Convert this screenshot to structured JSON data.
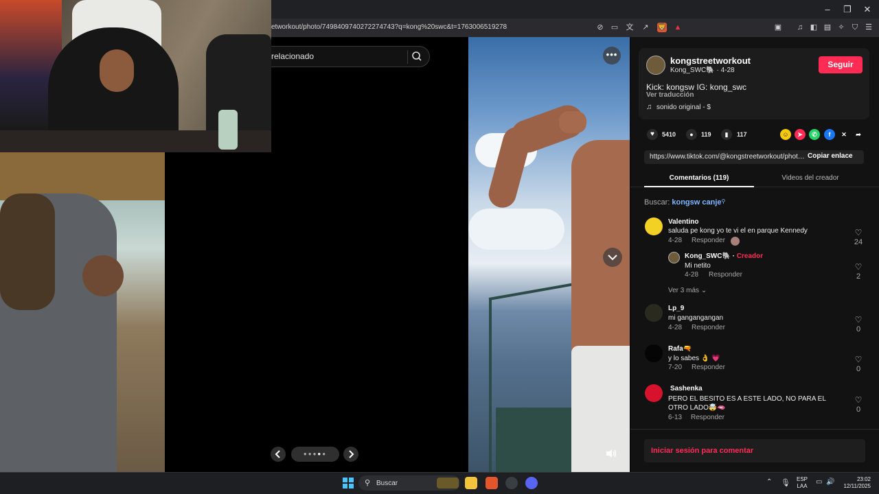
{
  "browser": {
    "url": "etworkout/photo/7498409740272274743?q=kong%20swc&t=1763006519278"
  },
  "search": {
    "text": "relacionado"
  },
  "post": {
    "username": "kongstreetworkout",
    "nickname": "Kong_SWC🐘",
    "date": "4-28",
    "follow_label": "Seguir",
    "caption": "Kick: kongsw IG: kong_swc",
    "translate": "Ver traducción",
    "sound": "sonido original - $",
    "likes": "5410",
    "comments": "119",
    "saves": "117",
    "link": "https://www.tiktok.com/@kongstreetworkout/photo/7498409740272274743",
    "copy_label": "Copiar enlace"
  },
  "tabs": {
    "comments": "Comentarios (119)",
    "videos": "Videos del creador"
  },
  "search_suggestion": {
    "prefix": "Buscar:",
    "query": "kongsw canje"
  },
  "comments": [
    {
      "user": "Valentino",
      "text": "saluda pe kong yo te vi el en parque Kennedy",
      "date": "4-28",
      "reply": "Responder",
      "likes": "24"
    },
    {
      "user": "Kong_SWC🐘",
      "badge": "Creador",
      "text": "Mi netito",
      "date": "4-28",
      "reply": "Responder",
      "likes": "2"
    },
    {
      "user": "Lp_9",
      "text": "mi gangangangan",
      "date": "4-28",
      "reply": "Responder",
      "likes": "0"
    },
    {
      "user": "Rafa🔫",
      "text": "y lo sabes 👌 💗",
      "date": "7-20",
      "reply": "Responder",
      "likes": "0"
    },
    {
      "user": "Sashenka",
      "text": "PERO EL BESITO ES A ESTE LADO, NO PARA EL OTRO LADO🤯🫦",
      "date": "6-13",
      "reply": "Responder",
      "likes": "0"
    }
  ],
  "more_replies": "Ver 3 más",
  "login_prompt": "Iniciar sesión para comentar",
  "taskbar": {
    "search": "Buscar",
    "lang": "ESP",
    "layout": "LAA",
    "time": "23:02",
    "date": "12/11/2025"
  },
  "colors": {
    "accent": "#fe2c55",
    "panel": "#121212"
  }
}
